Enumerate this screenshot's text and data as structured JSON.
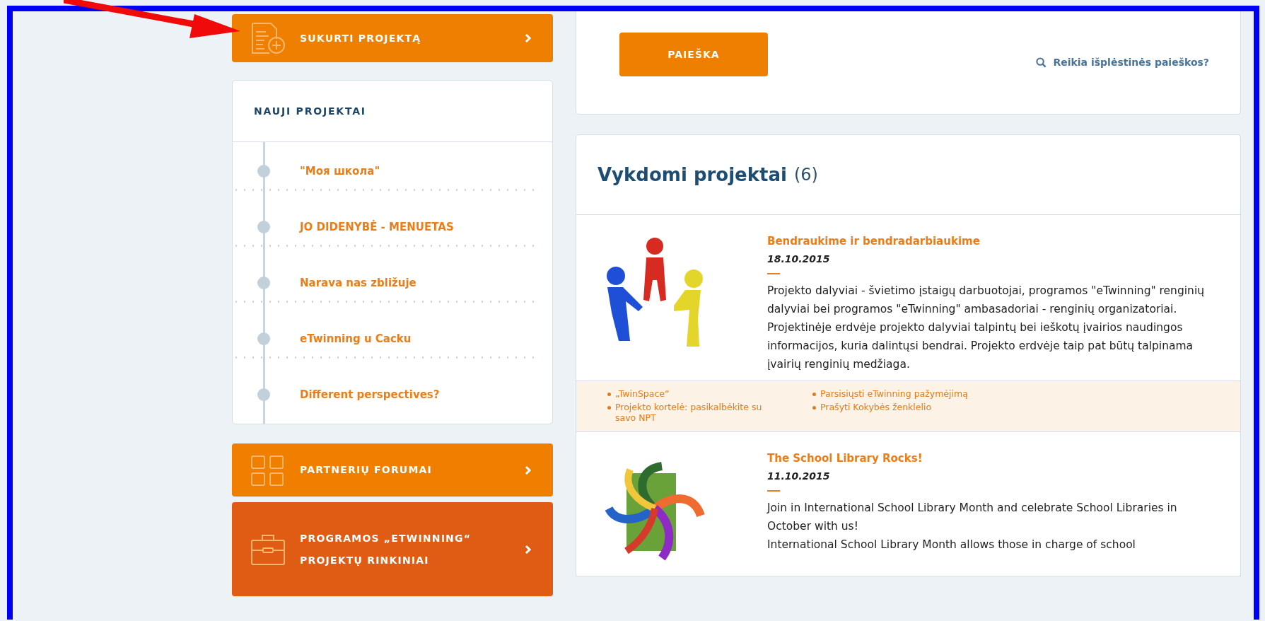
{
  "action_button": {
    "label": "SUKURTI PROJEKTĄ"
  },
  "new_projects": {
    "title": "NAUJI PROJEKTAI",
    "items": [
      {
        "label": "\"Моя школа\""
      },
      {
        "label": "JO DIDENYBĖ - MENUETAS"
      },
      {
        "label": "Narava nas zbližuje"
      },
      {
        "label": "eTwinning u Cacku"
      },
      {
        "label": "Different perspectives?"
      }
    ]
  },
  "side_buttons": [
    {
      "kind": "forum",
      "label": "PARTNERIŲ FORUMAI"
    },
    {
      "kind": "collection",
      "label": "PROGRAMOS „ETWINNING“ PROJEKTŲ RINKINIAI"
    }
  ],
  "search": {
    "button": "PAIEŠKA",
    "advanced_link": "Reikia išplėstinės paieškos?"
  },
  "running_projects": {
    "title": "Vykdomi projektai",
    "count": "(6)",
    "projects": [
      {
        "kind": "people",
        "title": "Bendraukime ir bendradarbiaukime",
        "date": "18.10.2015",
        "description": [
          "Projekto dalyviai - švietimo įstaigų darbuotojai, programos \"eTwinning\" renginių dalyviai bei programos \"eTwinning\" ambasadoriai - renginių organizatoriai.",
          "Projektinėje erdvėje projekto dalyviai talpintų bei ieškotų įvairios naudingos informacijos, kuria dalintųsi bendrai. Projekto erdvėje taip pat būtų talpinama įvairių renginių medžiaga."
        ],
        "links": [
          "„TwinSpace“",
          "Projekto kortelė: pasikalbėkite su savo NPT",
          "Parsisiųsti eTwinning pažymėjimą",
          "Prašyti Kokybės ženklelio"
        ]
      },
      {
        "kind": "library",
        "title": "The School Library Rocks!",
        "date": "11.10.2015",
        "description": [
          "Join in International School Library Month and celebrate School Libraries in October with us!",
          "International School Library Month allows those in charge of school"
        ]
      }
    ]
  }
}
